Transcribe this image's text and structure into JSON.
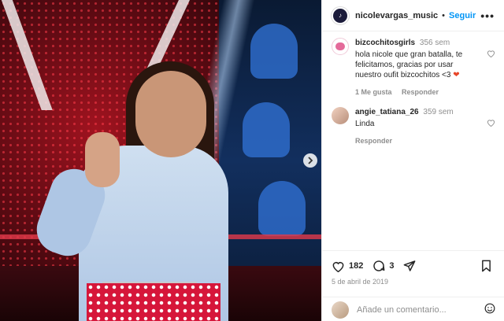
{
  "post": {
    "username": "nicolevargas_music",
    "follow_label": "Seguir",
    "separator": "•",
    "more_label": "•••",
    "like_count": "182",
    "comment_count": "3",
    "date": "5 de abril de 2019",
    "next_icon": "chevron-right-icon"
  },
  "comments": [
    {
      "username": "bizcochitosgirls",
      "time": "356 sem",
      "text": "hola nicole que gran batalla, te felicitamos, gracias por usar nuestro oufit bizcochitos <3",
      "emoji": "❤",
      "likes_label": "1 Me gusta",
      "reply_label": "Responder"
    },
    {
      "username": "angie_tatiana_26",
      "time": "359 sem",
      "text": "Linda",
      "reply_label": "Responder"
    }
  ],
  "add_comment": {
    "placeholder": "Añade un comentario..."
  },
  "colors": {
    "accent": "#0095f6",
    "text": "#262626",
    "muted": "#8e8e8e",
    "heart": "#e8472a"
  }
}
